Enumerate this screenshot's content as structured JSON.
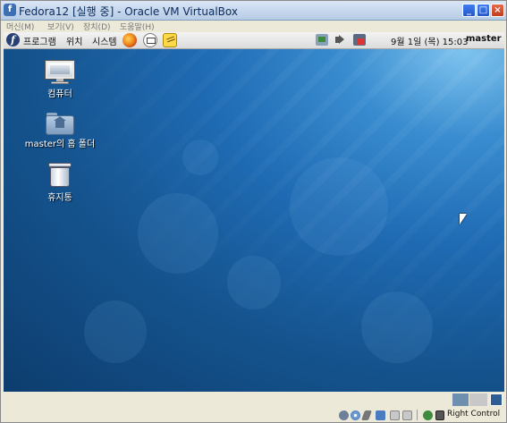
{
  "window": {
    "title": "Fedora12 [실행 중] - Oracle VM VirtualBox",
    "app_icon_glyph": "f"
  },
  "vb_menu": [
    "머신(M)",
    "보기(V)",
    "장치(D)",
    "도움말(H)"
  ],
  "panel": {
    "menus": [
      "프로그램",
      "위치",
      "시스템"
    ],
    "clock": "9월  1일 (목) 15:03",
    "user": "master",
    "launchers": [
      "firefox-icon",
      "mail-icon",
      "notes-icon"
    ],
    "tray": [
      "network-icon",
      "volume-icon",
      "update-icon"
    ]
  },
  "desktop": {
    "icons": [
      {
        "label": "컴퓨터",
        "icon": "computer-icon"
      },
      {
        "label": "master의 홈 폴더",
        "icon": "home-folder-icon"
      },
      {
        "label": "휴지통",
        "icon": "trash-icon"
      }
    ]
  },
  "statusbar": {
    "host_key": "Right Control",
    "indicators": [
      "hdd-icon",
      "cd-icon",
      "usb-icon",
      "network-icon",
      "shared-folder-icon",
      "capture-icon",
      "mouse-integration-icon",
      "host-key-icon"
    ]
  },
  "colors": {
    "desktop_dark": "#0d3d6e",
    "desktop_light": "#7fc4ef",
    "titlebar": "#b6cbe6"
  }
}
